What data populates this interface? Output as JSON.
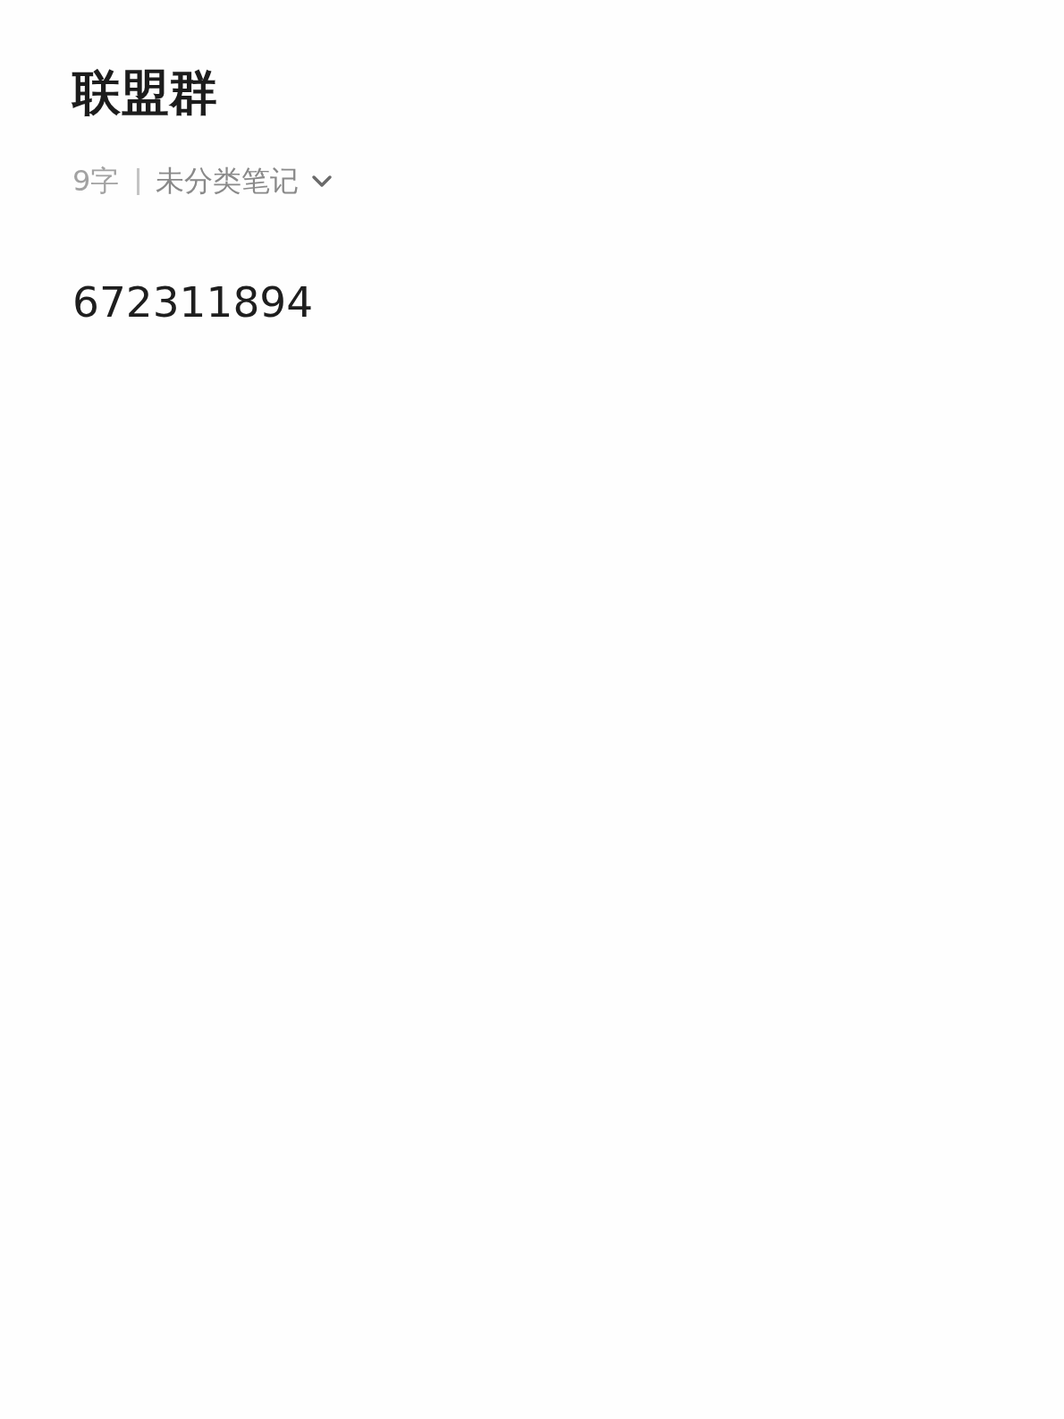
{
  "note": {
    "title": "联盟群",
    "word_count": "9字",
    "category": "未分类笔记",
    "body": "672311894"
  }
}
